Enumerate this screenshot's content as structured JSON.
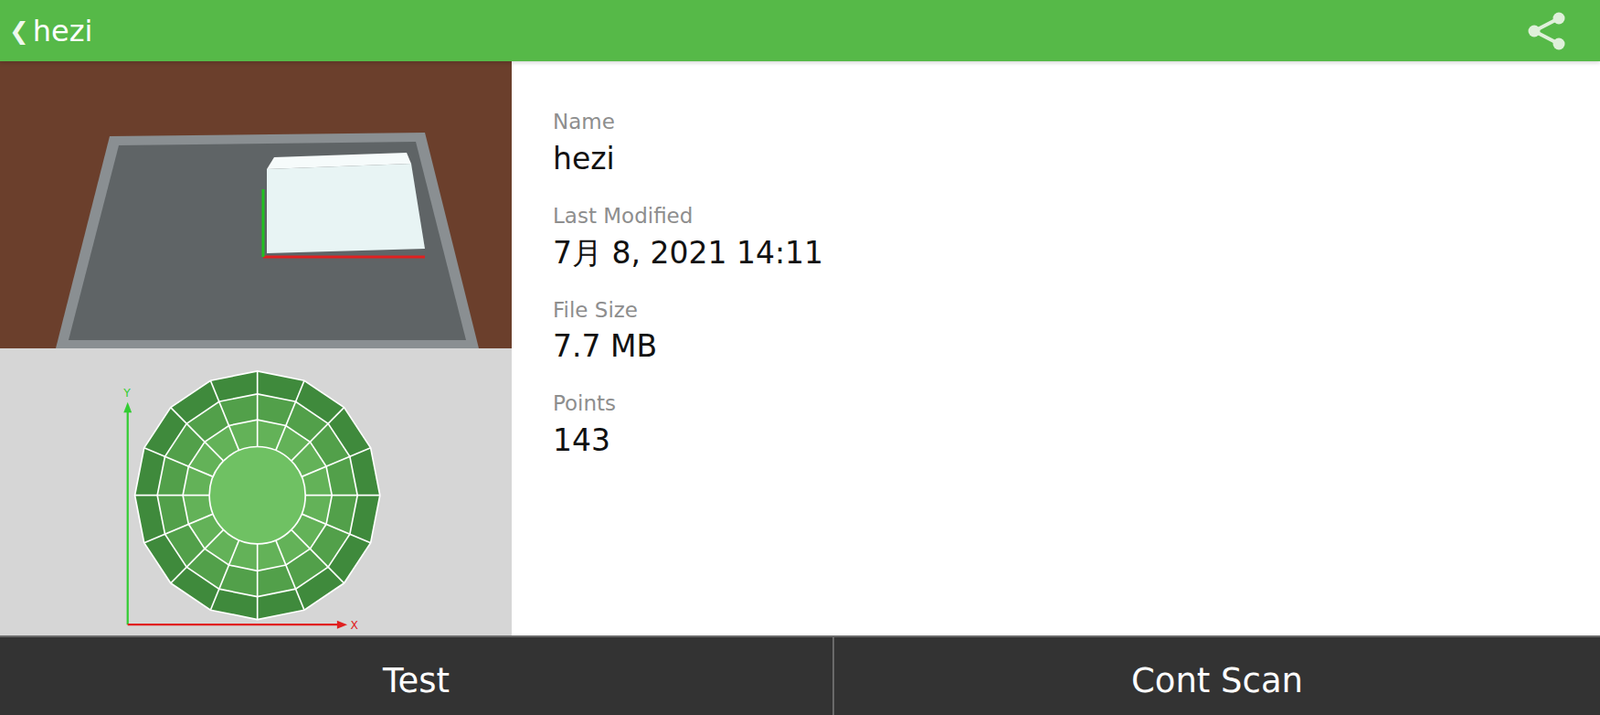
{
  "header": {
    "back": "❮",
    "title": "hezi"
  },
  "details": [
    {
      "label": "Name",
      "value": "hezi"
    },
    {
      "label": "Last Modified",
      "value": "7月 8, 2021 14:11"
    },
    {
      "label": "File Size",
      "value": "7.7 MB"
    },
    {
      "label": "Points",
      "value": "143"
    }
  ],
  "diagram": {
    "x_label": "X",
    "y_label": "Y"
  },
  "buttons": [
    "Test",
    "Cont Scan"
  ]
}
